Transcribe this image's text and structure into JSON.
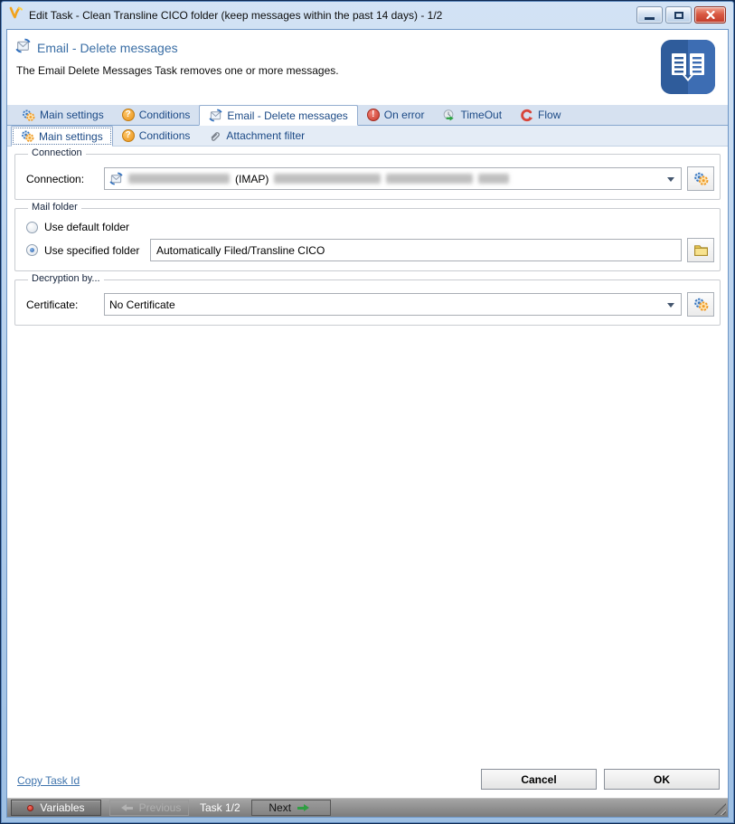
{
  "window": {
    "title": "Edit Task - Clean Transline CICO folder (keep messages within the past 14 days) - 1/2"
  },
  "header": {
    "title": "Email - Delete messages",
    "description": "The Email Delete Messages Task removes one or more messages."
  },
  "task_tabs": [
    {
      "label": "Main settings"
    },
    {
      "label": "Conditions"
    },
    {
      "label": "Email - Delete messages"
    },
    {
      "label": "On error"
    },
    {
      "label": "TimeOut"
    },
    {
      "label": "Flow"
    }
  ],
  "sub_tabs": [
    {
      "label": "Main settings"
    },
    {
      "label": "Conditions"
    },
    {
      "label": "Attachment filter"
    }
  ],
  "connection": {
    "legend": "Connection",
    "label": "Connection:",
    "visible_value": "(IMAP)"
  },
  "mail_folder": {
    "legend": "Mail folder",
    "option_default": "Use default folder",
    "option_specified": "Use specified folder",
    "folder_path": "Automatically Filed/Transline CICO"
  },
  "decryption": {
    "legend": "Decryption by...",
    "label": "Certificate:",
    "value": "No Certificate"
  },
  "footer": {
    "copy_task_id": "Copy Task Id",
    "cancel": "Cancel",
    "ok": "OK"
  },
  "statusbar": {
    "variables": "Variables",
    "previous": "Previous",
    "task_counter": "Task 1/2",
    "next": "Next"
  },
  "icons": {
    "question_glyph": "?",
    "error_glyph": "!"
  },
  "colors": {
    "accent_blue": "#3a6ea5",
    "tab_text": "#1c4a86",
    "link": "#3f74ad",
    "error_red": "#c93a2c",
    "warning_orange": "#e8921a",
    "success_green": "#2da344",
    "flow_red": "#d8453a"
  }
}
